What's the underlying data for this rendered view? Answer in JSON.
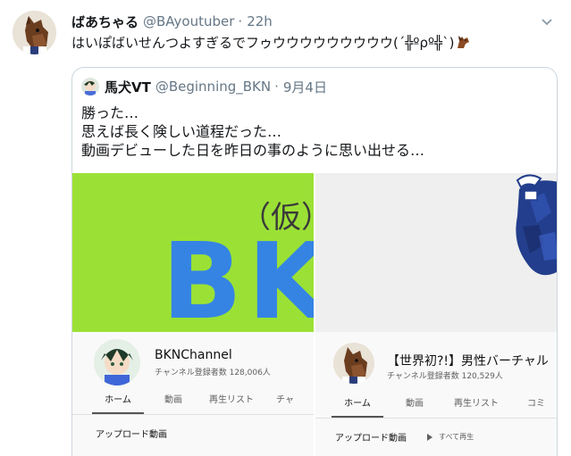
{
  "tweet": {
    "display_name": "ばあちゃる",
    "handle": "@BAyoutuber",
    "separator": "·",
    "time": "22h",
    "text": "はいぽばいせんつよすぎるでフゥウウウウウウウウウ(´╬ºρº╬`)",
    "emoji": "horse-emoji"
  },
  "quote": {
    "display_name": "馬犬VT",
    "handle": "@Beginning_BKN",
    "separator": "·",
    "date": "9月4日",
    "lines": [
      "勝った…",
      "思えば長く険しい道程だった…",
      "動画デビューした日を昨日の事のように思い出せる…"
    ]
  },
  "left_panel": {
    "banner_paren": "（仮）",
    "banner_text": "BKN",
    "channel_name": "BKNChannel",
    "subscribers": "チャンネル登録者数 128,006人",
    "tabs": [
      "ホーム",
      "動画",
      "再生リスト",
      "チャ"
    ],
    "active_tab": 0,
    "section_label": "アップロード動画"
  },
  "right_panel": {
    "channel_name": "【世界初?!】男性バーチャル",
    "subscribers": "チャンネル登録者数 120,529人",
    "tabs": [
      "ホーム",
      "動画",
      "再生リスト",
      "コミ"
    ],
    "active_tab": 0,
    "section_label": "アップロード動画",
    "play_all": "すべて再生"
  },
  "colors": {
    "banner_green": "#9be135",
    "banner_blue": "#3584e4",
    "link_gray": "#657786",
    "border": "#ccd6dd"
  }
}
